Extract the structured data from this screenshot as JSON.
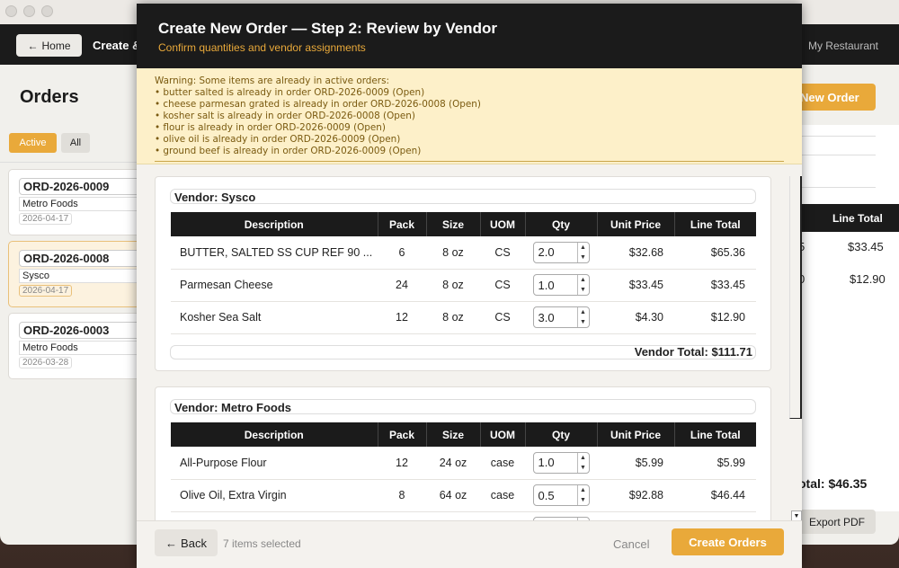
{
  "app": {
    "home_label": "Home",
    "header_title": "Create &",
    "restaurant": "My Restaurant",
    "orders_title": "Orders",
    "filters": {
      "active": "Active",
      "all": "All"
    },
    "new_order": "New Order",
    "orders": [
      {
        "id": "ORD-2026-0009",
        "vendor": "Metro Foods",
        "date": "2026-04-17"
      },
      {
        "id": "ORD-2026-0008",
        "vendor": "Sysco",
        "date": "2026-04-17"
      },
      {
        "id": "ORD-2026-0003",
        "vendor": "Metro Foods",
        "date": "2026-03-28"
      }
    ],
    "detail": {
      "line_total_header": "Line Total",
      "rows": [
        {
          "left": "5",
          "value": "$33.45"
        },
        {
          "left": "0",
          "value": "$12.90"
        }
      ],
      "total": "otal: $46.35",
      "export_label": "Export PDF"
    }
  },
  "modal": {
    "title": "Create New Order — Step 2: Review by Vendor",
    "subtitle": "Confirm quantities and vendor assignments",
    "warning": {
      "heading": "Warning: Some items are already in active orders:",
      "lines": [
        "• butter salted is already in order ORD-2026-0009 (Open)",
        "• cheese parmesan grated is already in order ORD-2026-0008 (Open)",
        "• kosher salt is already in order ORD-2026-0008 (Open)",
        "• flour is already in order ORD-2026-0009 (Open)",
        "• olive oil is already in order ORD-2026-0009 (Open)",
        "• ground beef is already in order ORD-2026-0009 (Open)"
      ]
    },
    "columns": [
      "Description",
      "Pack",
      "Size",
      "UOM",
      "Qty",
      "Unit Price",
      "Line Total"
    ],
    "vendors": [
      {
        "name": "Vendor: Sysco",
        "items": [
          {
            "desc": "BUTTER, SALTED SS CUP REF 90 ...",
            "pack": "6",
            "size": "8 oz",
            "uom": "CS",
            "qty": "2.0",
            "price": "$32.68",
            "total": "$65.36"
          },
          {
            "desc": "Parmesan Cheese",
            "pack": "24",
            "size": "8 oz",
            "uom": "CS",
            "qty": "1.0",
            "price": "$33.45",
            "total": "$33.45"
          },
          {
            "desc": "Kosher Sea Salt",
            "pack": "12",
            "size": "8 oz",
            "uom": "CS",
            "qty": "3.0",
            "price": "$4.30",
            "total": "$12.90"
          }
        ],
        "total": "Vendor Total: $111.71"
      },
      {
        "name": "Vendor: Metro Foods",
        "items": [
          {
            "desc": "All-Purpose Flour",
            "pack": "12",
            "size": "24 oz",
            "uom": "case",
            "qty": "1.0",
            "price": "$5.99",
            "total": "$5.99"
          },
          {
            "desc": "Olive Oil, Extra Virgin",
            "pack": "8",
            "size": "64 oz",
            "uom": "case",
            "qty": "0.5",
            "price": "$92.88",
            "total": "$46.44"
          }
        ]
      }
    ],
    "footer": {
      "back_label": "Back",
      "selected": "7 items selected",
      "cancel_label": "Cancel",
      "create_label": "Create Orders"
    }
  },
  "colors": {
    "accent": "#e9a93a",
    "dark": "#1b1b1b",
    "warning_bg": "#fdf0c9",
    "warning_text": "#7a5a10"
  }
}
